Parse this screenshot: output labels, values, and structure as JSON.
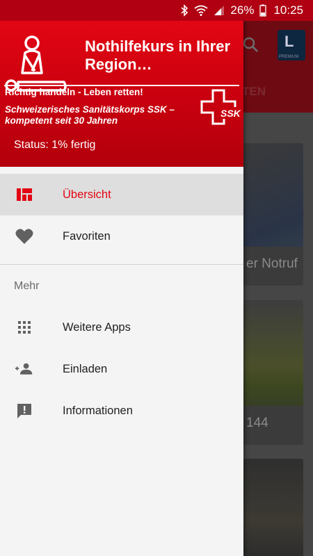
{
  "status_bar": {
    "battery_percent": "26%",
    "time": "10:25",
    "icons": [
      "bluetooth-icon",
      "wifi-icon",
      "signal-icon",
      "battery-icon"
    ]
  },
  "background": {
    "tab_label": "TEN",
    "premium_badge_letter": "L",
    "premium_badge_text": "PREMIUM",
    "cards": [
      {
        "caption": "er Notruf"
      },
      {
        "caption": "144"
      },
      {
        "caption": ""
      }
    ]
  },
  "drawer": {
    "header": {
      "title": "Nothilfekurs in Ihrer Region…",
      "tagline": "Richtig handeln - Leben retten!",
      "org_line": "Schweizerisches Sanitätskorps SSK – kompetent seit 30 Jahren",
      "ssk_text": "SSK",
      "status": "Status: 1% fertig"
    },
    "items": [
      {
        "label": "Übersicht",
        "icon": "dashboard-icon",
        "active": true
      },
      {
        "label": "Favoriten",
        "icon": "heart-icon",
        "active": false
      }
    ],
    "section_title": "Mehr",
    "more_items": [
      {
        "label": "Weitere Apps",
        "icon": "apps-grid-icon"
      },
      {
        "label": "Einladen",
        "icon": "add-person-icon"
      },
      {
        "label": "Informationen",
        "icon": "feedback-icon"
      }
    ]
  },
  "colors": {
    "accent": "#e30613",
    "header_red": "#c8000f",
    "status_bar": "#b00012",
    "drawer_bg": "#f4f4f4",
    "active_row": "#dedede"
  }
}
